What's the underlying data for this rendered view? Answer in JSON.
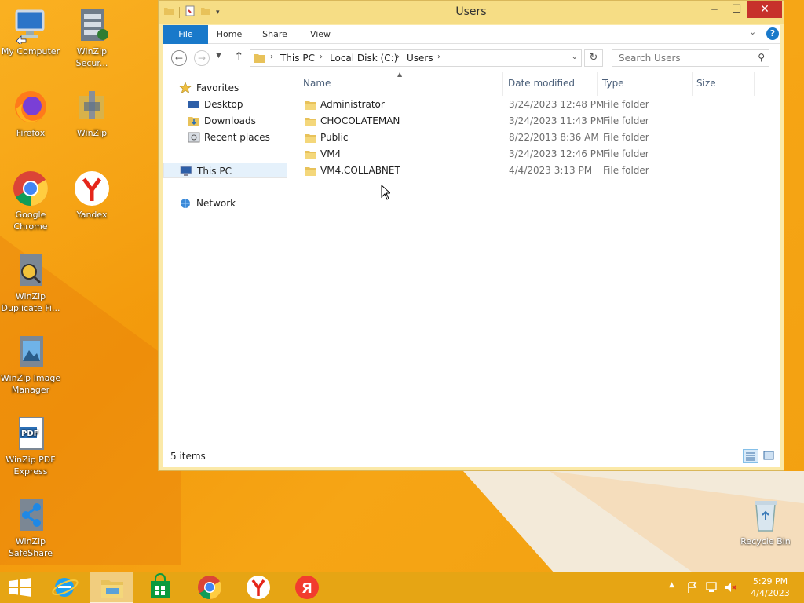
{
  "window": {
    "title": "Users",
    "controls": {
      "minimize": "‒",
      "maximize": "☐",
      "close": "✕"
    }
  },
  "ribbon": {
    "tabs": [
      "File",
      "Home",
      "Share",
      "View"
    ],
    "help": "?"
  },
  "address": {
    "crumbs": [
      "This PC",
      "Local Disk (C:)",
      "Users"
    ],
    "search_placeholder": "Search Users"
  },
  "nav_pane": {
    "favorites": "Favorites",
    "favorite_items": [
      "Desktop",
      "Downloads",
      "Recent places"
    ],
    "this_pc": "This PC",
    "network": "Network"
  },
  "file_list": {
    "columns": [
      "Name",
      "Date modified",
      "Type",
      "Size"
    ],
    "rows": [
      {
        "name": "Administrator",
        "date": "3/24/2023 12:48 PM",
        "type": "File folder"
      },
      {
        "name": "CHOCOLATEMAN",
        "date": "3/24/2023 11:43 PM",
        "type": "File folder"
      },
      {
        "name": "Public",
        "date": "8/22/2013 8:36 AM",
        "type": "File folder"
      },
      {
        "name": "VM4",
        "date": "3/24/2023 12:46 PM",
        "type": "File folder"
      },
      {
        "name": "VM4.COLLABNET",
        "date": "4/4/2023 3:13 PM",
        "type": "File folder"
      }
    ]
  },
  "status": {
    "count": "5 items"
  },
  "desktop_icons": [
    {
      "label": "My Computer",
      "icon": "computer-icon"
    },
    {
      "label": "WinZip Secur...",
      "icon": "winzip-secure-icon"
    },
    {
      "label": "Firefox",
      "icon": "firefox-icon"
    },
    {
      "label": "WinZip",
      "icon": "winzip-icon"
    },
    {
      "label": "Google Chrome",
      "icon": "chrome-icon"
    },
    {
      "label": "Yandex",
      "icon": "yandex-icon"
    },
    {
      "label": "WinZip Duplicate Fi...",
      "icon": "winzip-duplicate-icon"
    },
    {
      "label": "WinZip Image Manager",
      "icon": "winzip-image-icon"
    },
    {
      "label": "WinZip PDF Express",
      "icon": "winzip-pdf-icon"
    },
    {
      "label": "WinZip SafeShare",
      "icon": "winzip-safeshare-icon"
    },
    {
      "label": "Recycle Bin",
      "icon": "recycle-bin-icon"
    }
  ],
  "taskbar": {
    "clock_time": "5:29 PM",
    "clock_date": "4/4/2023",
    "pinned": [
      "start-icon",
      "internet-explorer-icon",
      "file-explorer-icon",
      "store-icon",
      "chrome-icon",
      "yandex-icon",
      "yandex-browser-icon"
    ]
  },
  "colors": {
    "accent": "#1979ca",
    "window_frame": "#fbe9a8",
    "taskbar": "#e6a514",
    "close": "#c7312b"
  }
}
